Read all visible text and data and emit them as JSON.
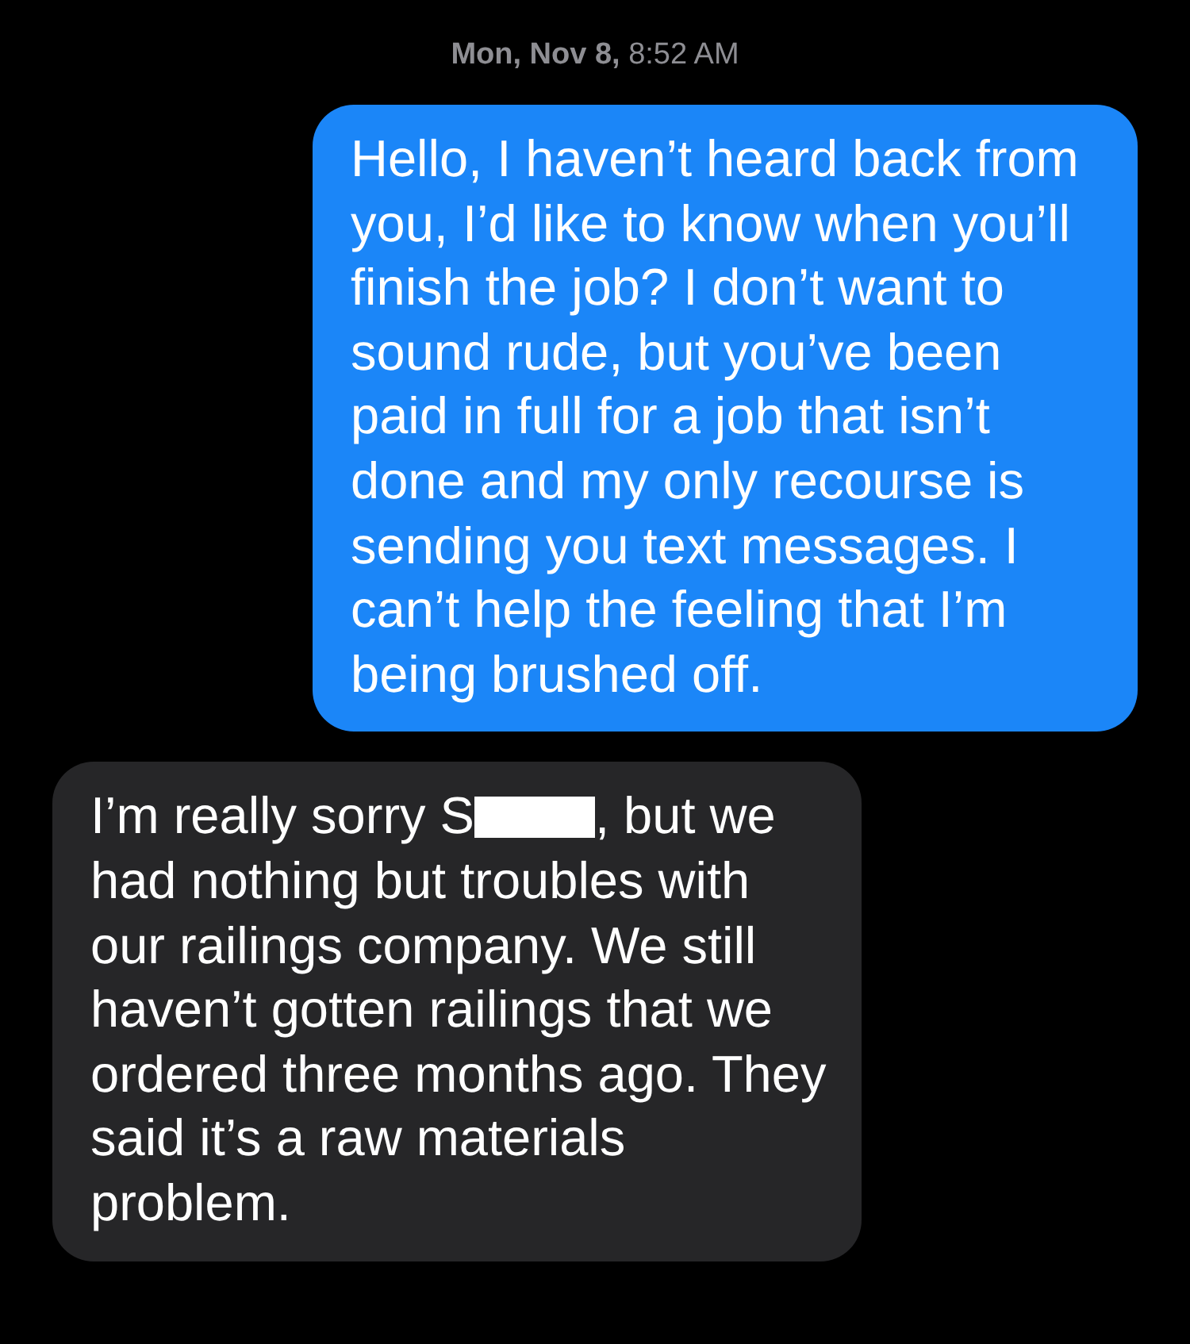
{
  "timestamp": "**Mon, Nov 8,** 8:52 AM",
  "messages": [
    {
      "kind": "sent",
      "text": "Hello, I haven’t heard back from you, I’d like to know when you’ll finish the job? I don’t want to sound rude, but you’ve been paid in full for a job that isn’t done and my only recourse is sending you text messages. I can’t help the feeling that I’m being brushed off."
    },
    {
      "kind": "received",
      "text_before": "I’m really sorry S",
      "redacted": true,
      "text_after": ", but we had nothing but troubles with our railings company. We still haven’t gotten railings that we ordered three months ago. They said it’s a raw materials problem."
    }
  ]
}
